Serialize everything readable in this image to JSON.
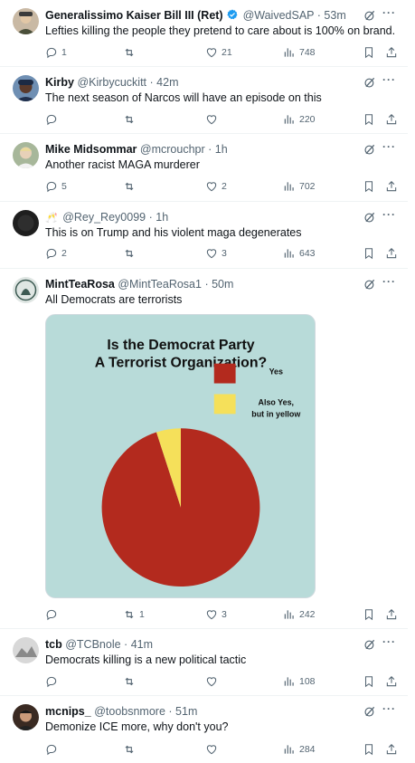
{
  "posts": [
    {
      "name": "Generalissimo Kaiser Bill III (Ret)",
      "handle": "@WaivedSAP",
      "time": "53m",
      "text": "Lefties killing the people they pretend to care about is 100% on brand.",
      "replies": "1",
      "reposts": "",
      "likes": "21",
      "views": "748"
    },
    {
      "name": "Kirby",
      "handle": "@Kirbycuckitt",
      "time": "42m",
      "text": "The next season of Narcos will have an episode on this",
      "replies": "",
      "reposts": "",
      "likes": "",
      "views": "220"
    },
    {
      "name": "Mike Midsommar",
      "handle": "@mcrouchpr",
      "time": "1h",
      "text": "Another racist MAGA murderer",
      "replies": "5",
      "reposts": "",
      "likes": "2",
      "views": "702"
    },
    {
      "name": "",
      "handle": "@Rey_Rey0099",
      "time": "1h",
      "text": "This is on Trump and his violent maga  degenerates",
      "replies": "2",
      "reposts": "",
      "likes": "3",
      "views": "643"
    },
    {
      "name": "MintTeaRosa",
      "handle": "@MintTeaRosa1",
      "time": "50m",
      "text": "All Democrats are terrorists",
      "replies": "",
      "reposts": "1",
      "likes": "3",
      "views": "242"
    },
    {
      "name": "tcb",
      "handle": "@TCBnole",
      "time": "41m",
      "text": "Democrats killing is a new political tactic",
      "replies": "",
      "reposts": "",
      "likes": "",
      "views": "108"
    },
    {
      "name": "mcnips_",
      "handle": "@toobsnmore",
      "time": "51m",
      "text": "Demonize ICE more, why don't you?",
      "replies": "",
      "reposts": "",
      "likes": "",
      "views": "284"
    }
  ],
  "chart_data": {
    "type": "pie",
    "title": "Is the Democrat Party A Terrorist Organization?",
    "title_lines": [
      "Is the Democrat Party",
      "A Terrorist Organization?"
    ],
    "categories": [
      "Yes",
      "Also Yes, but in yellow"
    ],
    "legend_lines": [
      [
        "Yes"
      ],
      [
        "Also Yes,",
        "but in yellow"
      ]
    ],
    "values": [
      95,
      5
    ],
    "colors": [
      "#b32a1e",
      "#f5e05a"
    ],
    "background": "#b8dbd9",
    "legend_position": "top-right"
  },
  "colors": {
    "verified": "#1d9bf0",
    "muted": "#536471",
    "text": "#0f1419"
  },
  "icons": [
    "verified-badge-icon",
    "grok-icon",
    "more-icon",
    "reply-icon",
    "repost-icon",
    "like-icon",
    "views-icon",
    "bookmark-icon",
    "share-icon",
    "emoji-icon"
  ]
}
